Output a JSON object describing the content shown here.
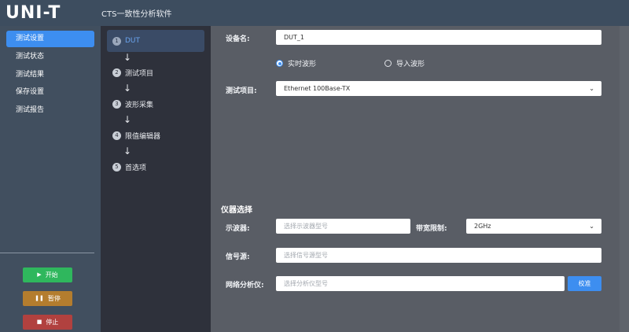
{
  "app": {
    "logo": "UNI-T",
    "title": "CTS一致性分析软件"
  },
  "nav": {
    "items": [
      {
        "label": "测试设置",
        "active": true
      },
      {
        "label": "测试状态",
        "active": false
      },
      {
        "label": "测试结果",
        "active": false
      },
      {
        "label": "保存设置",
        "active": false
      },
      {
        "label": "测试报告",
        "active": false
      }
    ],
    "controls": {
      "start": "开始",
      "pause": "暂停",
      "stop": "停止"
    }
  },
  "steps": [
    {
      "num": "1",
      "label": "DUT",
      "active": true
    },
    {
      "num": "2",
      "label": "测试项目",
      "active": false
    },
    {
      "num": "3",
      "label": "波形采集",
      "active": false
    },
    {
      "num": "4",
      "label": "限值编辑器",
      "active": false
    },
    {
      "num": "5",
      "label": "首选项",
      "active": false
    }
  ],
  "arrow_glyph": "↓",
  "dut": {
    "device_label": "设备名:",
    "device_value": "DUT_1",
    "radio_realtime": "实时波形",
    "radio_import": "导入波形",
    "test_item_label": "测试项目:",
    "test_item_value": "Ethernet 100Base-TX"
  },
  "instruments": {
    "title": "仪器选择",
    "scope_label": "示波器:",
    "scope_placeholder": "选择示波器型号",
    "bandwidth_label": "带宽限制:",
    "bandwidth_value": "2GHz",
    "siggen_label": "信号源:",
    "siggen_placeholder": "选择信号源型号",
    "vna_label": "网络分析仪:",
    "vna_placeholder": "选择分析仪型号",
    "calibrate": "校准"
  },
  "colors": {
    "accent": "#3d8ef0",
    "start": "#2fb75d",
    "pause": "#b47d2e",
    "stop": "#b1413f"
  }
}
